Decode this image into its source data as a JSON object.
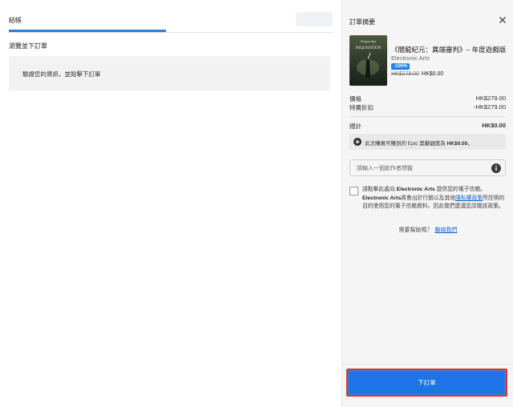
{
  "left": {
    "tab_label": "結帳",
    "section_title": "瀏覽並下訂單",
    "verify_text": "驗證您的資訊，並點擊下訂單"
  },
  "summary": {
    "title": "訂單摘要",
    "product": {
      "name": "《闇龍紀元：異端審判》– 年度遊戲版",
      "publisher": "Electronic Arts",
      "discount_badge": "-100%",
      "original_price": "HK$279.00",
      "final_price": "HK$0.00",
      "cover_text_top": "Dragon Age",
      "cover_text": "INQUISITION"
    },
    "price_label": "價格",
    "price_value": "HK$279.00",
    "discount_label": "特賣折扣",
    "discount_value": "-HK$279.00",
    "total_label": "總計",
    "total_value": "HK$0.00",
    "reward_text_prefix": "此次購買可賺到的 Epic 獎勵額度為 ",
    "reward_amount": "HK$0.00",
    "reward_suffix": "。",
    "creator_placeholder": "請輸入一個創作者標籤",
    "consent": {
      "part1": "請點擊此處向 ",
      "brand1": "Electronic Arts",
      "part2": " 提供您的電子信箱。",
      "brand2": "Electronic Arts",
      "part3": "將會出於行銷以及其他",
      "link": "隱私權政策",
      "part4": "所註明的目的使用您的電子信箱資料，因此我們建議您詳閱該政策。"
    },
    "help_text": "需要幫助嗎？",
    "help_link": "聯絡我們",
    "order_button": "下訂單"
  },
  "colors": {
    "accent": "#1c74e6",
    "highlight_border": "#e43030"
  }
}
